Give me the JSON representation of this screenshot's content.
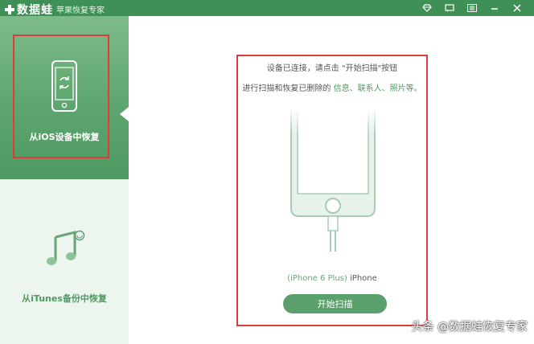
{
  "app": {
    "name": "数据蛙",
    "subtitle": "苹果恢复专家",
    "window_icons": [
      "diamond-icon",
      "message-icon",
      "menu-icon",
      "minimize-icon",
      "close-icon"
    ]
  },
  "sidebar": {
    "items": [
      {
        "label": "从iOS设备中恢复",
        "icon": "phone-sync-icon",
        "selected": true
      },
      {
        "label": "从iTunes备份中恢复",
        "icon": "itunes-music-icon",
        "selected": false
      }
    ]
  },
  "main": {
    "instruction_line1": "设备已连接，请点击 \"开始扫描\"按钮",
    "instruction_line2_prefix": "进行扫描和恢复已删除的 ",
    "instruction_line2_highlight": "信息、联系人、照片等。",
    "device_model": "(iPhone 6 Plus)",
    "device_name": " iPhone",
    "start_button": "开始扫描"
  },
  "watermark": "头条 @数据蛙恢复专家",
  "colors": {
    "brand_green": "#3f9056",
    "highlight_green": "#4f9a63",
    "annotation_red": "#e03b3b"
  }
}
